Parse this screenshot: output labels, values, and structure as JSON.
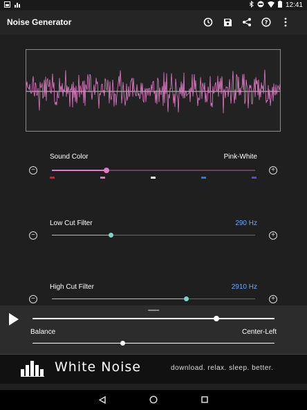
{
  "status_bar": {
    "time": "12:41"
  },
  "app_bar": {
    "title": "Noise Generator",
    "icons": [
      "timer-icon",
      "save-icon",
      "share-icon",
      "help-icon",
      "overflow-menu-icon"
    ]
  },
  "sound_color": {
    "label": "Sound Color",
    "value": "Pink-White",
    "level": 0.27,
    "color_ticks": [
      "#e0182a",
      "#ea6fc0",
      "#ffffff",
      "#1e78ff",
      "#6d3be6"
    ]
  },
  "low_cut": {
    "label": "Low Cut Filter",
    "value": "290 Hz",
    "level": 0.29
  },
  "high_cut": {
    "label": "High Cut Filter",
    "value": "2910 Hz",
    "level": 0.66
  },
  "player": {
    "volume_level": 0.76,
    "balance_label": "Balance",
    "balance_value": "Center-Left",
    "balance_level": 0.37
  },
  "banner": {
    "brand": "White Noise",
    "tagline": "download. relax. sleep. better."
  },
  "colors": {
    "accent_pink": "#e47bc7",
    "accent_teal": "#7fd4c8",
    "value_blue": "#6aa8ff"
  }
}
